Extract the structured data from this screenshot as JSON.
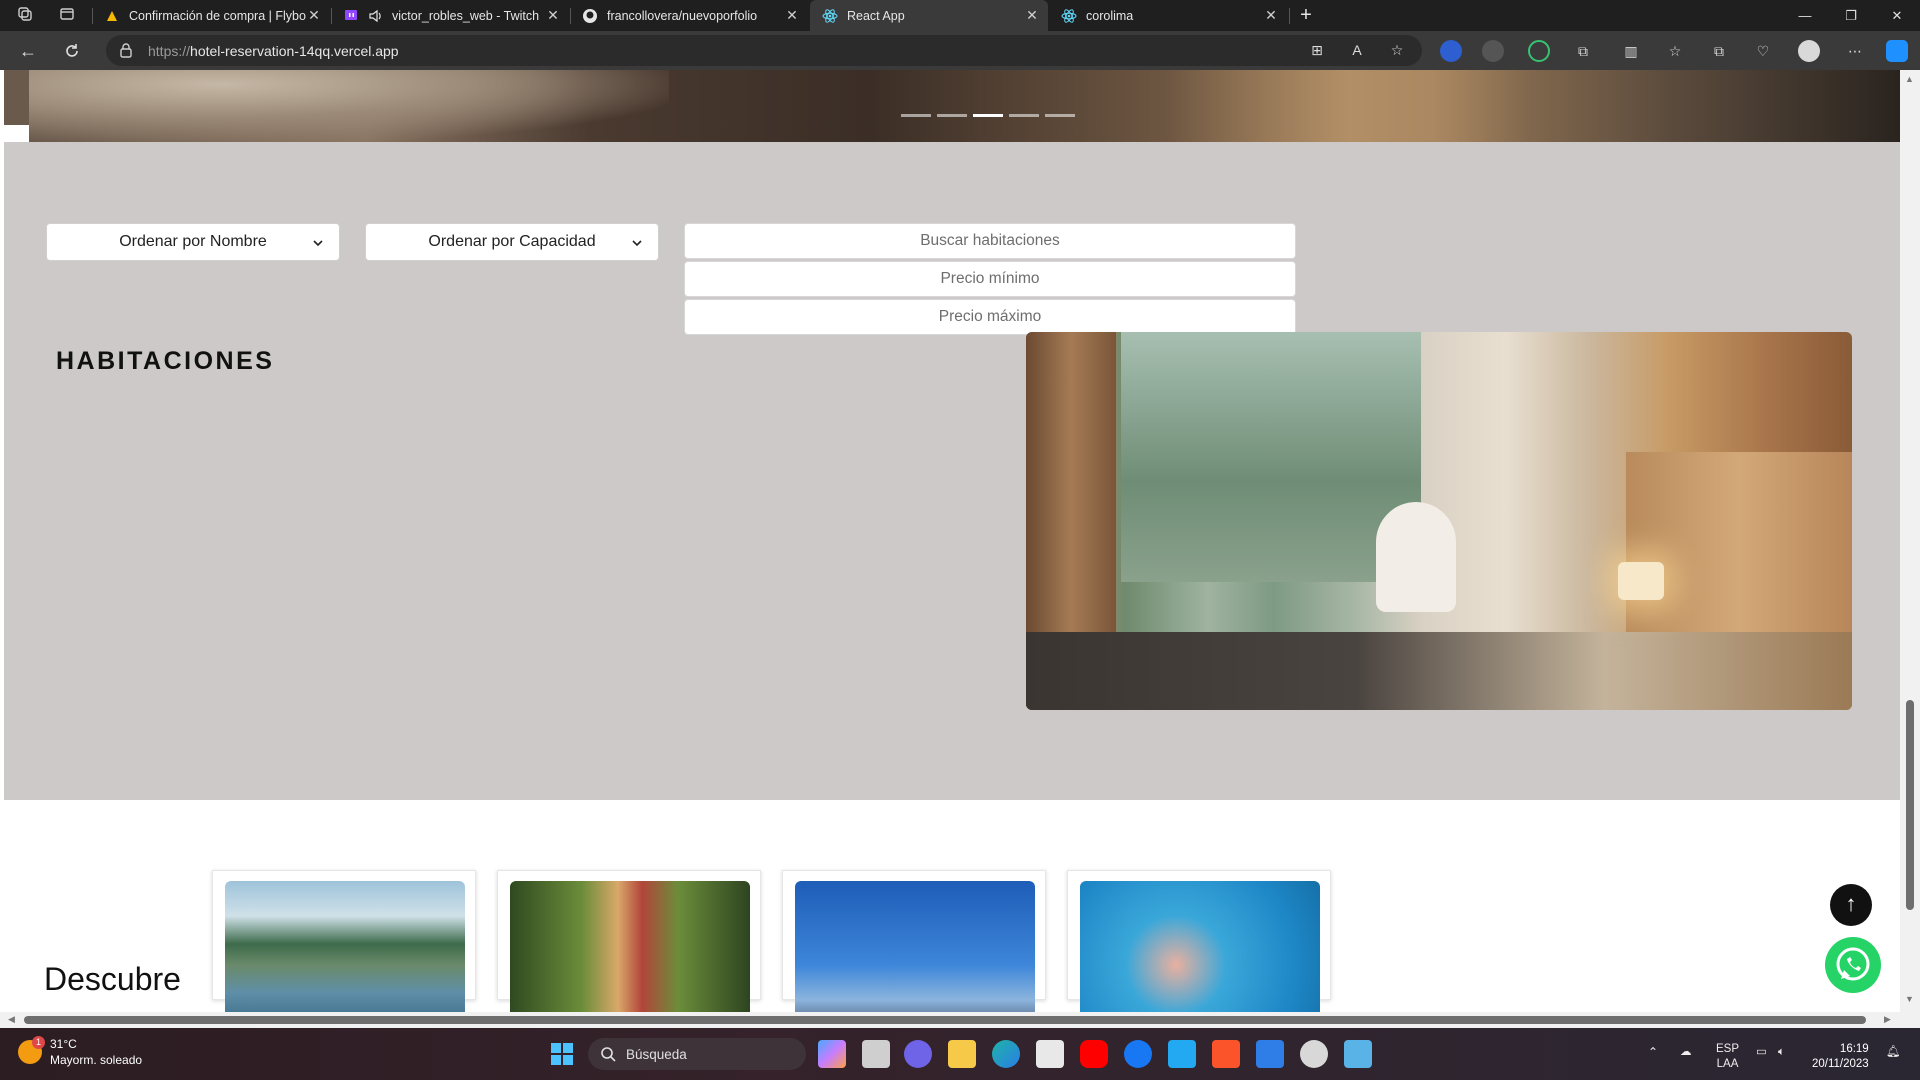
{
  "browser": {
    "tabs": [
      {
        "title": "Confirmación de compra | Flybondi",
        "favicon": "flybondi-icon",
        "active": false
      },
      {
        "title": "victor_robles_web - Twitch",
        "favicon": "twitch-icon",
        "active": false
      },
      {
        "title": "francollovera/nuevoporfolio",
        "favicon": "github-icon",
        "active": false
      },
      {
        "title": "React App",
        "favicon": "react-icon",
        "active": true
      },
      {
        "title": "corolima",
        "favicon": "react-icon",
        "active": false
      }
    ],
    "url_scheme": "https://",
    "url_host": "hotel-reservation-14qq.vercel.app"
  },
  "page": {
    "hero": {
      "dot_count": 5,
      "active_dot": 3
    },
    "filters": {
      "sort_name_label": "Ordenar por Nombre",
      "sort_capacity_label": "Ordenar por Capacidad",
      "search_placeholder": "Buscar habitaciones",
      "min_price_placeholder": "Precio mínimo",
      "max_price_placeholder": "Precio máximo"
    },
    "rooms_title": "HABITACIONES",
    "discover_title": "Descubre",
    "activity_cards": [
      "pool-photo",
      "hiker-photo",
      "yoga-photo",
      "kids-pool-photo"
    ],
    "colors": {
      "section_bg": "#cdc9c9",
      "whatsapp": "#25d366"
    }
  },
  "taskbar": {
    "weather_temp": "31°C",
    "weather_desc": "Mayorm. soleado",
    "weather_badge": "1",
    "search_label": "Búsqueda",
    "lang_top": "ESP",
    "lang_bottom": "LAA",
    "time": "16:19",
    "date": "20/11/2023"
  }
}
